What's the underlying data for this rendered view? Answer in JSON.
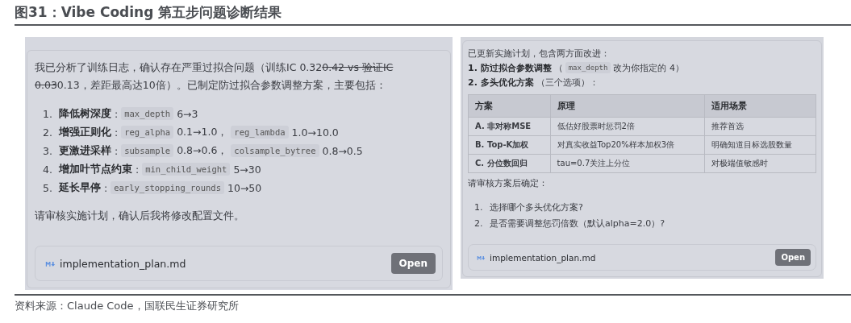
{
  "title": "图31：Vibe Coding 第五步问题诊断结果",
  "left_panel": {
    "intro": [
      {
        "text": "我已分析了训练日志，确认存在严重过拟合问题（训练IC 0.32",
        "struck": false
      },
      {
        "text": "0.42 vs 验证IC 0.03",
        "struck": true
      },
      {
        "text": "0.13，差距最高达10倍）。已制定防过拟合参数调整方案，主要包括：",
        "struck": false
      }
    ],
    "items": [
      {
        "number": "1.",
        "parts": [
          {
            "kind": "label",
            "text": "降低树深度"
          },
          {
            "kind": "text",
            "text": ":"
          },
          {
            "kind": "code",
            "text": "max_depth"
          },
          {
            "kind": "text",
            "text": "6→3"
          }
        ]
      },
      {
        "number": "2.",
        "parts": [
          {
            "kind": "label",
            "text": "增强正则化"
          },
          {
            "kind": "text",
            "text": ":"
          },
          {
            "kind": "code",
            "text": "reg_alpha"
          },
          {
            "kind": "text",
            "text": "0.1→1.0，"
          },
          {
            "kind": "code",
            "text": "reg_lambda"
          },
          {
            "kind": "text",
            "text": "1.0→10.0"
          }
        ]
      },
      {
        "number": "3.",
        "parts": [
          {
            "kind": "label",
            "text": "更激进采样"
          },
          {
            "kind": "text",
            "text": ":"
          },
          {
            "kind": "code",
            "text": "subsample"
          },
          {
            "kind": "text",
            "text": "0.8→0.6，"
          },
          {
            "kind": "code",
            "text": "colsample_bytree"
          },
          {
            "kind": "text",
            "text": "0.8→0.5"
          }
        ]
      },
      {
        "number": "4.",
        "parts": [
          {
            "kind": "label",
            "text": "增加叶节点约束"
          },
          {
            "kind": "text",
            "text": ":"
          },
          {
            "kind": "code",
            "text": "min_child_weight"
          },
          {
            "kind": "text",
            "text": "5→30"
          }
        ]
      },
      {
        "number": "5.",
        "parts": [
          {
            "kind": "label",
            "text": "延长早停"
          },
          {
            "kind": "text",
            "text": ":"
          },
          {
            "kind": "code",
            "text": "early_stopping_rounds"
          },
          {
            "kind": "text",
            "text": "10→50"
          }
        ]
      }
    ],
    "closing": "请审核实施计划，确认后我将修改配置文件。",
    "file": {
      "name": "implementation_plan.md",
      "button": "Open"
    }
  },
  "right_panel": {
    "intro": "已更新实施计划，包含两方面改进：",
    "points": [
      {
        "parts": [
          {
            "kind": "label",
            "text": "1. 防过拟合参数调整"
          },
          {
            "kind": "text",
            "text": "（"
          },
          {
            "kind": "code",
            "text": "max_depth"
          },
          {
            "kind": "text",
            "text": "改为你指定的 4）"
          }
        ]
      },
      {
        "parts": [
          {
            "kind": "label",
            "text": "2. 多头优化方案"
          },
          {
            "kind": "text",
            "text": "（三个选项）："
          }
        ]
      }
    ],
    "table": {
      "columns": [
        "方案",
        "原理",
        "适用场景"
      ],
      "rows": [
        [
          "A. 非对称MSE",
          "低估好股票时惩罚2倍",
          "推荐首选"
        ],
        [
          "B. Top-K加权",
          "对真实收益Top20%样本加权3倍",
          "明确知道目标选股数量"
        ],
        [
          "C. 分位数回归",
          "tau=0.7关注上分位",
          "对极端值敏感时"
        ]
      ]
    },
    "question": "请审核方案后确定：",
    "items": [
      {
        "number": "1.",
        "text": "选择哪个多头优化方案?"
      },
      {
        "number": "2.",
        "text": "是否需要调整惩罚倍数（默认alpha=2.0）?"
      }
    ],
    "file": {
      "name": "implementation_plan.md",
      "button": "Open"
    }
  },
  "source": "资料来源：Claude Code，国联民生证券研究所"
}
